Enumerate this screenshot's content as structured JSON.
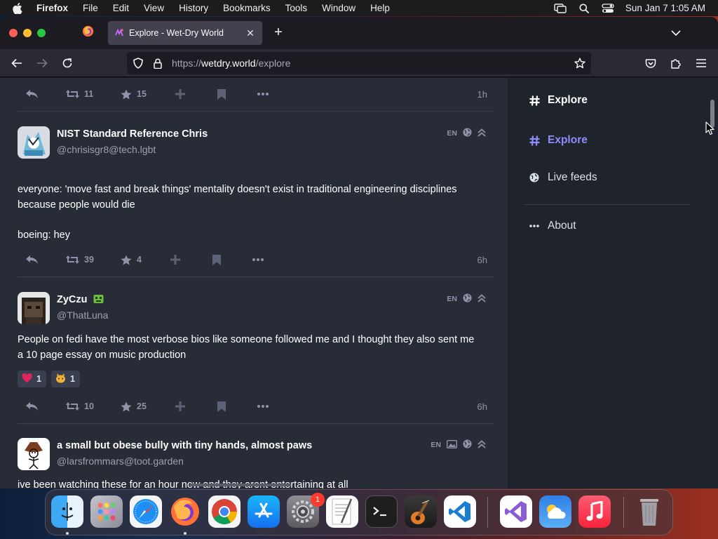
{
  "menubar": {
    "app_name": "Firefox",
    "items": [
      "File",
      "Edit",
      "View",
      "History",
      "Bookmarks",
      "Tools",
      "Window",
      "Help"
    ],
    "clock": "Sun Jan 7  1:05 AM"
  },
  "browser": {
    "tab_title": "Explore - Wet-Dry World",
    "url_scheme": "https://",
    "url_host": "wetdry.world",
    "url_path": "/explore"
  },
  "feed": {
    "top_actions": {
      "boosts": "11",
      "favourites": "15",
      "time": "1h"
    },
    "posts": [
      {
        "display_name": "NIST Standard Reference Chris",
        "handle": "@chrisisgr8@tech.lgbt",
        "language": "EN",
        "text_line1": "everyone: 'move fast and break things' mentality doesn't exist in traditional engineering disciplines",
        "text_line2": "because people would die",
        "text_line3": "boeing: hey",
        "boosts": "39",
        "favourites": "4",
        "time": "6h"
      },
      {
        "display_name": "ZyCzu",
        "handle": "@ThatLuna",
        "language": "EN",
        "text_line1": "People on fedi have the most verbose bios like someone followed me and I thought they also sent me",
        "text_line2": "a 10 page essay on music production",
        "reactions": [
          {
            "emoji": "heart",
            "count": "1"
          },
          {
            "emoji": "custom-creature",
            "count": "1"
          }
        ],
        "boosts": "10",
        "favourites": "25",
        "time": "6h"
      },
      {
        "display_name": "a small but obese bully with tiny hands, almost paws",
        "handle": "@larsfrommars@toot.garden",
        "language": "EN",
        "text_line1": "ive been watching these for an hour now and they arent entertaining at all"
      }
    ]
  },
  "sidebar": {
    "heading": "Explore",
    "items": [
      {
        "label": "Explore",
        "icon": "hash-icon",
        "active": true
      },
      {
        "label": "Live feeds",
        "icon": "globe-icon",
        "active": false
      },
      {
        "label": "About",
        "icon": "ellipsis-icon",
        "active": false
      }
    ]
  },
  "dock": {
    "apps": [
      "Finder",
      "Launchpad",
      "Safari",
      "Firefox",
      "Chrome",
      "App Store",
      "System Settings",
      "TextEdit",
      "Terminal",
      "GarageBand",
      "VS Code",
      "Visual Studio",
      "Weather",
      "Music",
      "Trash"
    ],
    "settings_badge": "1"
  }
}
